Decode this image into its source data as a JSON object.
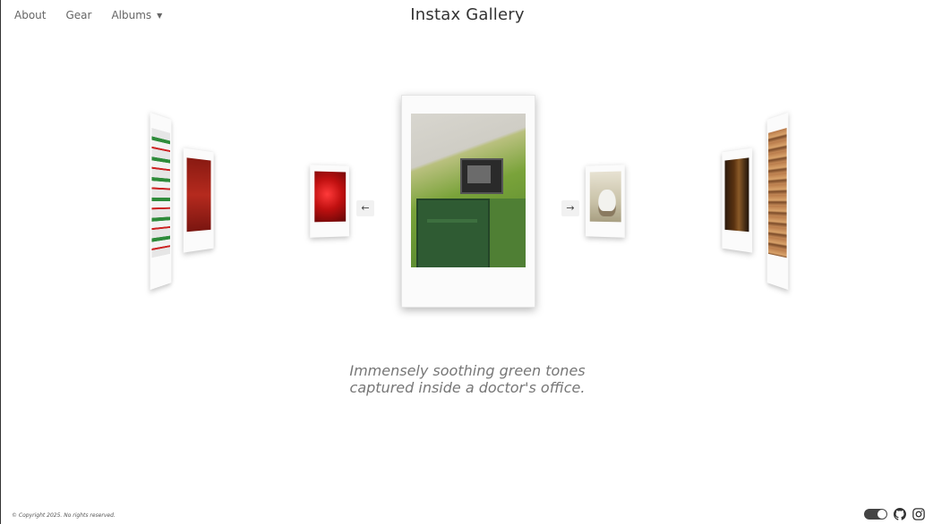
{
  "nav": {
    "about": "About",
    "gear": "Gear",
    "albums": "Albums",
    "albums_caret": "▼"
  },
  "site_title": "Instax Gallery",
  "carousel": {
    "prev_arrow": "←",
    "next_arrow": "→",
    "caption_line1": "Immensely soothing green tones",
    "caption_line2": "captured inside a doctor's office."
  },
  "footer": {
    "copyright": "© Copyright 2025. No rights reserved."
  },
  "icons": [
    "theme-toggle",
    "github-icon",
    "instagram-icon"
  ],
  "colors": {
    "accent": "#444444",
    "caption": "#777777"
  }
}
